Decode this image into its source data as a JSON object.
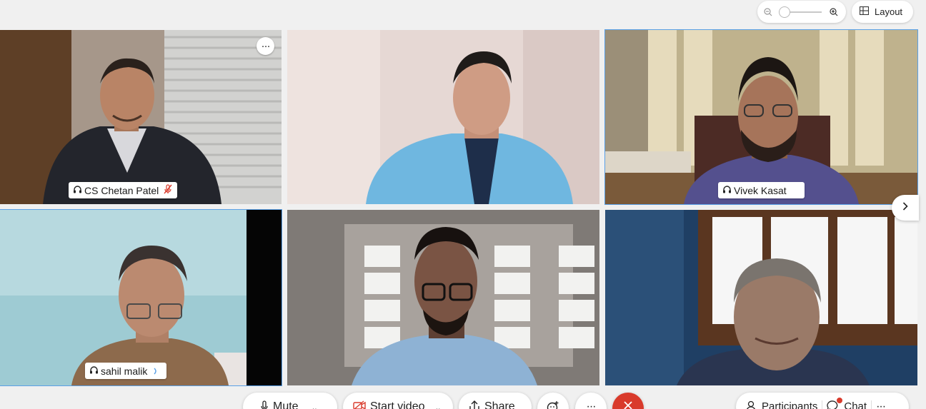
{
  "colors": {
    "accent": "#5aa0e6",
    "end_call": "#d93a2b",
    "mic_muted": "#d93a2b"
  },
  "header": {
    "layout_label": "Layout"
  },
  "tiles": [
    {
      "name": "CS Chetan Patel",
      "muted": true,
      "active": false,
      "has_label": true
    },
    {
      "name": "",
      "active": false,
      "has_label": false
    },
    {
      "name": "Vivek Kasat",
      "active": true,
      "has_label": true
    },
    {
      "name": "sahil malik",
      "active": true,
      "has_label": true
    },
    {
      "name": "",
      "active": false,
      "has_label": false
    },
    {
      "name": "",
      "active": false,
      "has_label": false
    }
  ],
  "controls": {
    "mute_label": "Mute",
    "start_video_label": "Start video",
    "share_label": "Share",
    "participants_label": "Participants",
    "chat_label": "Chat"
  }
}
